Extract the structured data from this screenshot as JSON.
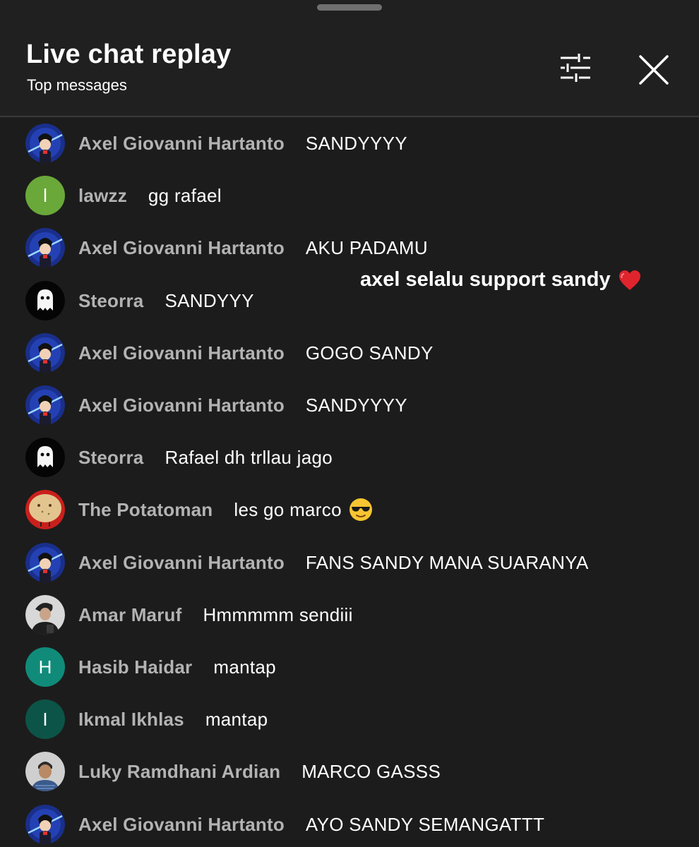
{
  "header": {
    "title": "Live chat replay",
    "subtitle": "Top messages",
    "filter_icon": "sliders-icon",
    "close_icon": "close-icon"
  },
  "overlay": {
    "caption": "axel selalu support sandy",
    "emoji": "red-heart"
  },
  "colors": {
    "background": "#1c1c1c",
    "header_background": "#202020",
    "author_text": "#b3b3b3",
    "message_text": "#ffffff",
    "avatar_green": "#6aa83a",
    "avatar_teal": "#108b7a",
    "avatar_dark_teal": "#0c5447"
  },
  "messages": [
    {
      "author": "Axel Giovanni Hartanto",
      "text": "SANDYYYY",
      "avatar": "anime-avatar"
    },
    {
      "author": "lawzz",
      "text": "gg rafael",
      "avatar": "letter",
      "initial": "l",
      "avatar_color": "#6aa83a"
    },
    {
      "author": "Axel Giovanni Hartanto",
      "text": "AKU PADAMU",
      "avatar": "anime-avatar"
    },
    {
      "author": "Steorra",
      "text": "SANDYYY",
      "avatar": "ghost-avatar"
    },
    {
      "author": "Axel Giovanni Hartanto",
      "text": "GOGO SANDY",
      "avatar": "anime-avatar"
    },
    {
      "author": "Axel Giovanni Hartanto",
      "text": "SANDYYYY",
      "avatar": "anime-avatar"
    },
    {
      "author": "Steorra",
      "text": "Rafael dh trllau jago",
      "avatar": "ghost-avatar"
    },
    {
      "author": "The Potatoman",
      "text": "les go marco",
      "avatar": "potato-avatar",
      "emoji": "sunglasses-face"
    },
    {
      "author": "Axel Giovanni Hartanto",
      "text": "FANS SANDY MANA SUARANYA",
      "avatar": "anime-avatar"
    },
    {
      "author": "Amar Maruf",
      "text": "Hmmmmm sendiii",
      "avatar": "photo-avatar"
    },
    {
      "author": "Hasib Haidar",
      "text": "mantap",
      "avatar": "letter",
      "initial": "H",
      "avatar_color": "#108b7a"
    },
    {
      "author": "Ikmal Ikhlas",
      "text": "mantap",
      "avatar": "letter",
      "initial": "I",
      "avatar_color": "#0c5447"
    },
    {
      "author": "Luky Ramdhani Ardian",
      "text": "MARCO GASSS",
      "avatar": "photo-avatar-2"
    },
    {
      "author": "Axel Giovanni Hartanto",
      "text": "AYO SANDY SEMANGATTT",
      "avatar": "anime-avatar"
    }
  ]
}
